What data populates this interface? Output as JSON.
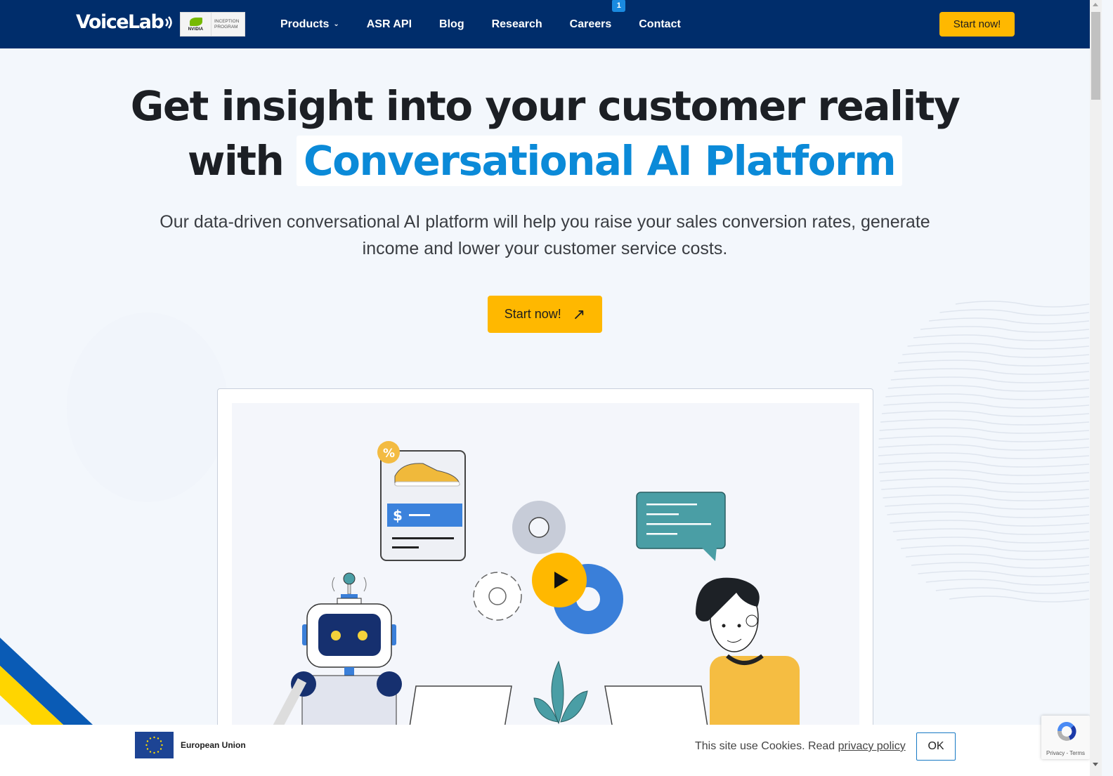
{
  "navbar": {
    "logo_text": "VoiceLab",
    "partner_badge": {
      "brand": "NVIDIA",
      "line1": "INCEPTION",
      "line2": "PROGRAM"
    },
    "links": [
      {
        "label": "Products",
        "has_dropdown": true
      },
      {
        "label": "ASR API"
      },
      {
        "label": "Blog"
      },
      {
        "label": "Research"
      },
      {
        "label": "Careers",
        "badge": "1"
      },
      {
        "label": "Contact"
      }
    ],
    "cta_label": "Start now!"
  },
  "hero": {
    "headline_line1": "Get insight into your customer reality",
    "headline_line2_prefix": "with",
    "headline_accent": "Conversational AI Platform",
    "subtitle": "Our data-driven conversational AI platform will help you raise your sales conversion rates, generate income and lower your customer service costs.",
    "cta_label": "Start now!",
    "cta_icon": "arrow-up-right-icon"
  },
  "video": {
    "play_icon": "play-icon",
    "illustration": [
      "robot",
      "product-card-shoe",
      "gears",
      "chat-bubble",
      "person",
      "plant",
      "laptops"
    ]
  },
  "cookie_bar": {
    "eu_label": "European Union",
    "text": "This site use Cookies. Read ",
    "link_text": "privacy policy",
    "ok_label": "OK"
  },
  "recaptcha": {
    "label": "Privacy - Terms"
  },
  "colors": {
    "nav_bg": "#002d6b",
    "accent_yellow": "#ffb800",
    "accent_blue": "#0b8ad8",
    "page_bg": "#f3f7fc",
    "badge_blue": "#1a8ae0"
  }
}
